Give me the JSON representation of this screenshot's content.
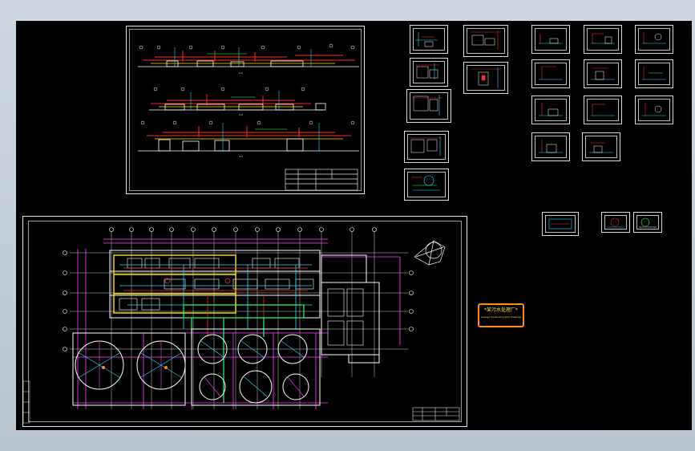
{
  "viewport": {
    "background": "#000000",
    "page_background": "#c6d0da"
  },
  "colors": {
    "red": "#ff2a2a",
    "yellow": "#ffe600",
    "magenta": "#ff3cff",
    "cyan": "#26e0ff",
    "green": "#2cff6a",
    "white": "#ffffff",
    "orange": "#ff8c1a"
  },
  "elevation_sheet": {
    "section_labels": [
      "1-1",
      "2-2",
      "3-3"
    ],
    "title_block": {
      "rows": 4
    }
  },
  "plan_sheet": {
    "north_arrow": "north-arrow-icon",
    "title_block": {
      "rows": 3
    }
  },
  "badge": {
    "line1": "*某污水处理厂*",
    "line2": "sewage treatment plant drawings"
  }
}
